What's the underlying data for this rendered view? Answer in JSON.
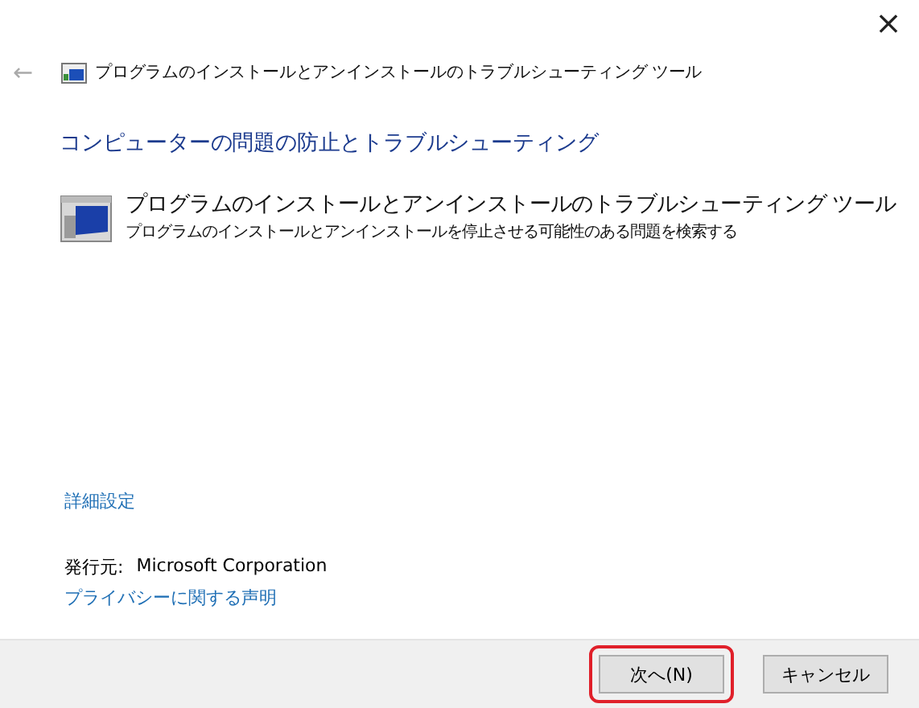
{
  "window": {
    "close": "×"
  },
  "nav": {
    "back": "←",
    "title": "プログラムのインストールとアンインストールのトラブルシューティング ツール"
  },
  "heading": "コンピューターの問題の防止とトラブルシューティング",
  "tool": {
    "title": "プログラムのインストールとアンインストールのトラブルシューティング ツール",
    "description": "プログラムのインストールとアンインストールを停止させる可能性のある問題を検索する"
  },
  "advanced_link": "詳細設定",
  "publisher": {
    "label": "発行元:",
    "value": "Microsoft Corporation"
  },
  "privacy_link": "プライバシーに関する声明",
  "buttons": [
    {
      "label": "次へ(N)",
      "highlighted": true
    },
    {
      "label": "キャンセル",
      "highlighted": false
    }
  ]
}
